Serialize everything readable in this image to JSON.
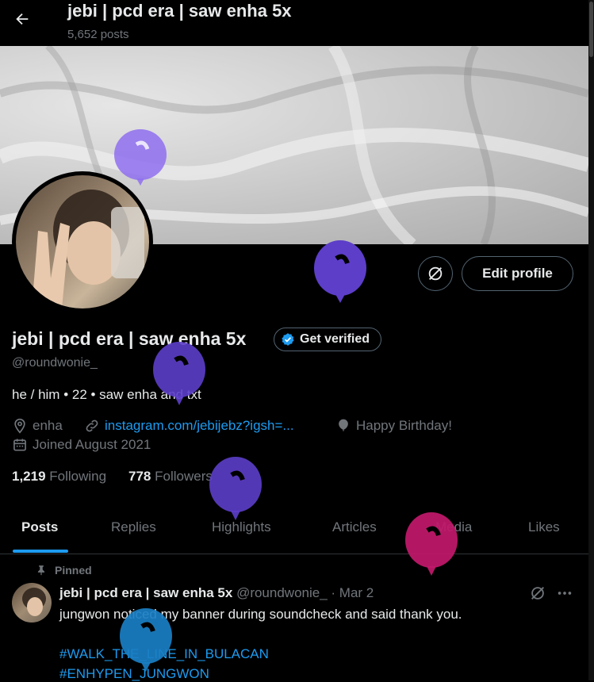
{
  "header": {
    "title": "jebi | pcd era | saw enha 5x",
    "post_count": "5,652 posts"
  },
  "profile": {
    "name": "jebi | pcd era | saw enha 5x",
    "verify_label": "Get verified",
    "handle": "@roundwonie_",
    "bio": "he / him • 22 • saw enha and txt",
    "location": "enha",
    "link": "instagram.com/jebijebz?igsh=...",
    "birthday": "Happy Birthday!",
    "joined": "Joined August 2021",
    "following_count": "1,219",
    "following_label": "Following",
    "followers_count": "778",
    "followers_label": "Followers"
  },
  "actions": {
    "edit_profile": "Edit profile"
  },
  "tabs": [
    {
      "label": "Posts",
      "active": true
    },
    {
      "label": "Replies"
    },
    {
      "label": "Highlights"
    },
    {
      "label": "Articles"
    },
    {
      "label": "Media"
    },
    {
      "label": "Likes"
    }
  ],
  "pinned_post": {
    "pinned_label": "Pinned",
    "author_name": "jebi | pcd era | saw enha 5x",
    "author_handle": "@roundwonie_",
    "date": "· Mar 2",
    "text": "jungwon noticed my banner during soundcheck and said thank you.",
    "hashtags": [
      "#WALK_THE_LINE_IN_BULACAN",
      "#ENHYPEN_JUNGWON"
    ]
  },
  "colors": {
    "accent": "#1d9bf0",
    "background": "#000000",
    "balloon_purple_light": "#8f6ef0",
    "balloon_purple": "#5c3ec9",
    "balloon_magenta": "#c2196b",
    "balloon_blue": "#1a7fc4"
  },
  "icons": [
    "back-arrow-icon",
    "grok-icon",
    "verified-badge-icon",
    "location-icon",
    "link-icon",
    "balloon-icon",
    "calendar-icon",
    "pin-icon",
    "more-icon"
  ]
}
